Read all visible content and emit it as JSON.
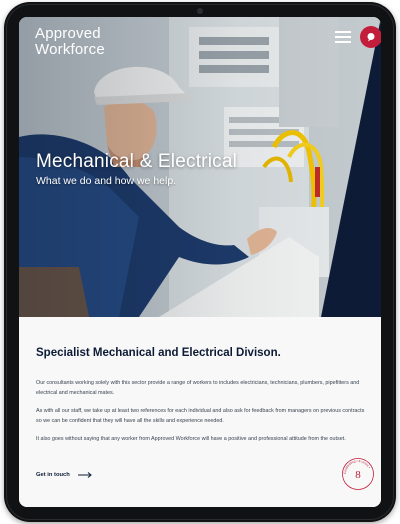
{
  "brand": {
    "logo_line1": "Approved",
    "logo_line2": "Workforce",
    "accent_color": "#c21d3a",
    "navy_color": "#0d1b36"
  },
  "header": {
    "menu_icon": "hamburger-menu-icon",
    "contact_icon": "chat-bubble-icon"
  },
  "hero": {
    "title": "Mechanical & Electrical",
    "subtitle": "What we do and how we help."
  },
  "section": {
    "title": "Specialist Mechanical and Electrical Divison.",
    "paragraphs": [
      "Our consultants working solely with this sector provide a range of workers to includes electricians, technicians, plumbers, pipefitters and electrical and mechanical mates.",
      "As with all our staff, we take up at least two references for each individual and also ask for feedback from managers on previous contracts so we can be confident that they will have all the skills and experience needed.",
      "It also goes without saying that any worker from Approved Workforce will have a positive and professional attitude from the outset."
    ],
    "cta_label": "Get in touch"
  },
  "seal": {
    "number": "8",
    "ring_text": "Celebrating • 8 years •"
  }
}
